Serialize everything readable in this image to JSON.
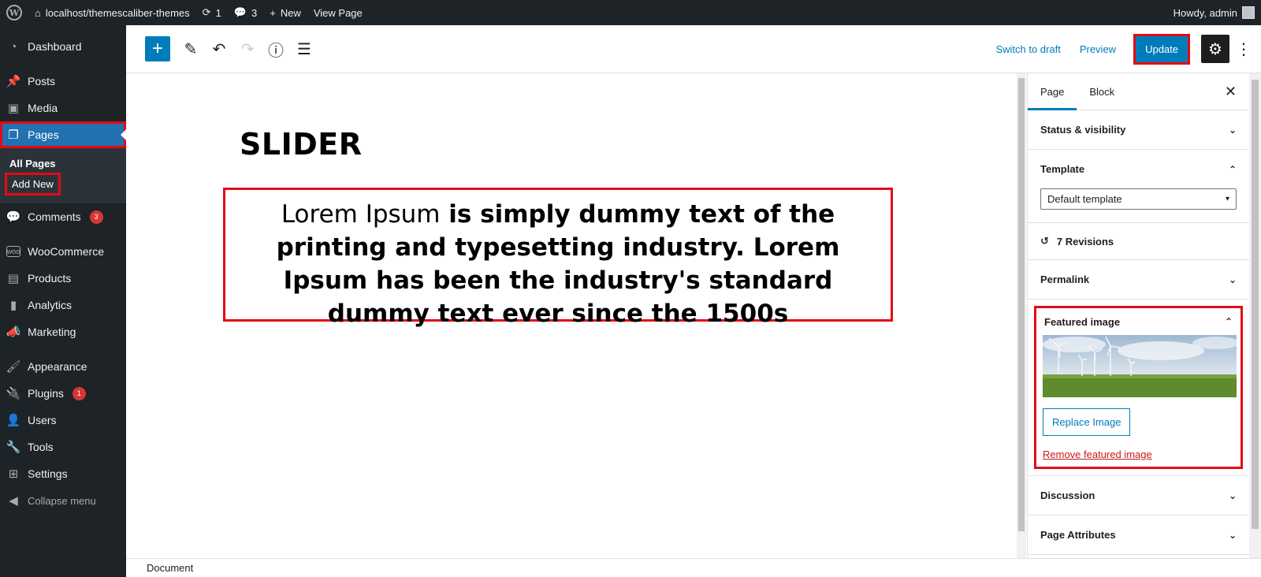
{
  "adminbar": {
    "site": "localhost/themescaliber-themes",
    "updates": "1",
    "comments": "3",
    "new": "New",
    "view": "View Page",
    "howdy": "Howdy, admin"
  },
  "sidebar": {
    "dashboard": "Dashboard",
    "posts": "Posts",
    "media": "Media",
    "pages": "Pages",
    "all_pages": "All Pages",
    "add_new": "Add New",
    "comments": "Comments",
    "comments_badge": "3",
    "woocommerce": "WooCommerce",
    "products": "Products",
    "analytics": "Analytics",
    "marketing": "Marketing",
    "appearance": "Appearance",
    "plugins": "Plugins",
    "plugins_badge": "1",
    "users": "Users",
    "tools": "Tools",
    "settings": "Settings",
    "collapse": "Collapse menu"
  },
  "header": {
    "switch_draft": "Switch to draft",
    "preview": "Preview",
    "update": "Update"
  },
  "content": {
    "title": "SLIDER",
    "para_normal": "Lorem Ipsum",
    "para_bold": " is simply dummy text of the printing and typesetting industry. Lorem Ipsum has been the industry's standard dummy text ever since the 1500s"
  },
  "panel": {
    "tab_page": "Page",
    "tab_block": "Block",
    "status": "Status & visibility",
    "template": "Template",
    "template_value": "Default template",
    "revisions": "7 Revisions",
    "permalink": "Permalink",
    "featured": "Featured image",
    "replace": "Replace Image",
    "remove": "Remove featured image",
    "discussion": "Discussion",
    "page_attributes": "Page Attributes"
  },
  "footer": {
    "breadcrumb": "Document"
  },
  "colors": {
    "accent": "#007cba",
    "admin_bg": "#1d2327",
    "highlight": "#e50914"
  }
}
